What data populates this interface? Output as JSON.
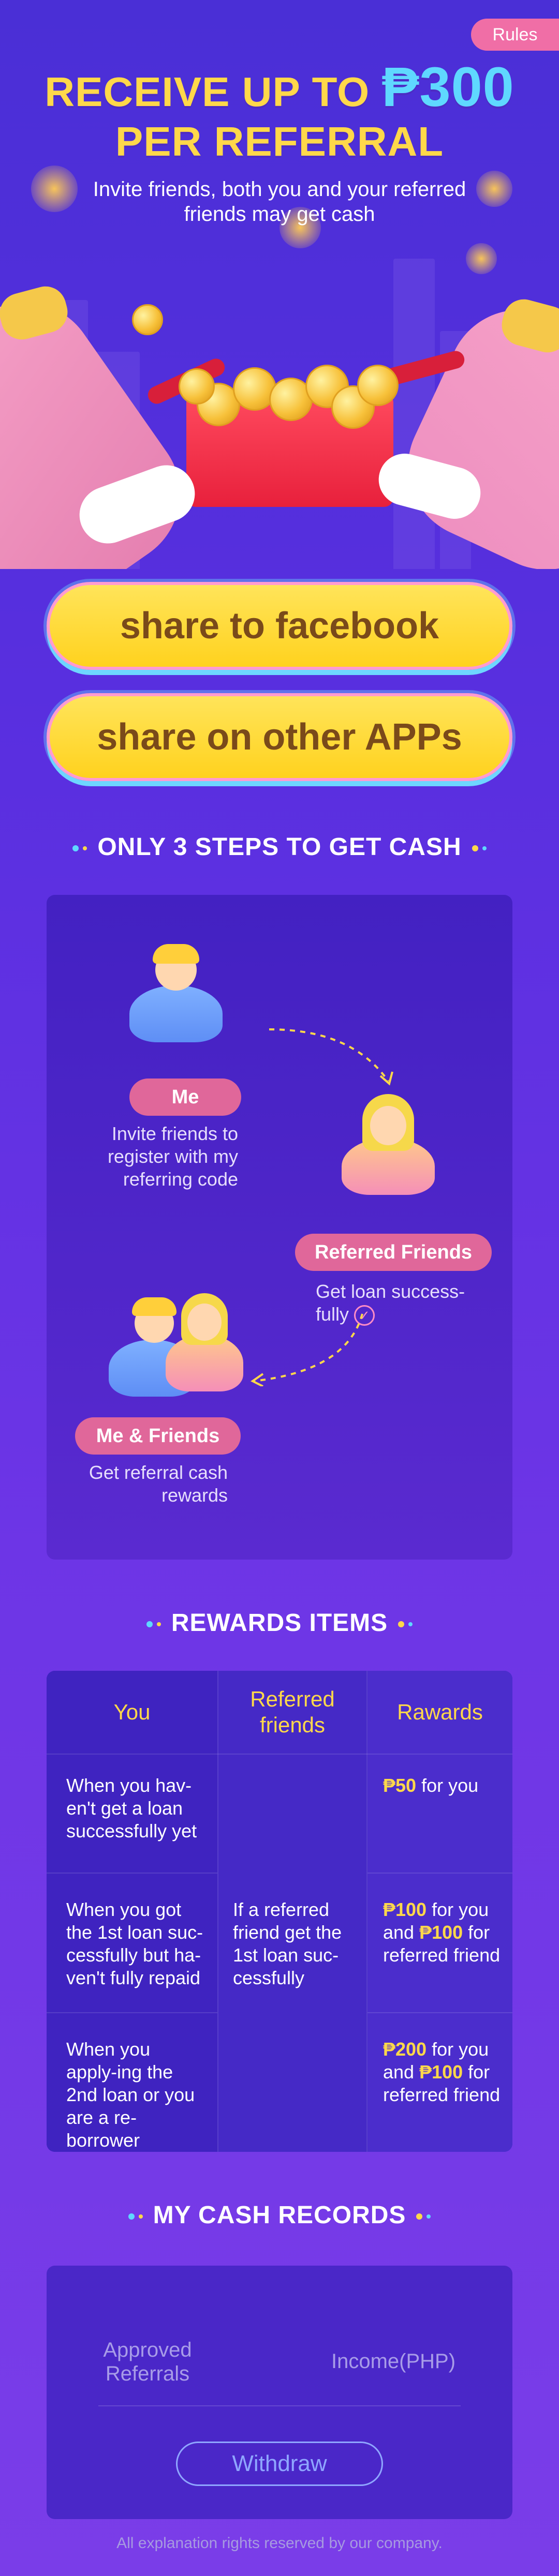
{
  "header": {
    "rules_label": "Rules",
    "title_line1_prefix": "RECEIVE UP TO ",
    "title_amount": "₱300",
    "title_line2": "PER REFERRAL",
    "subtitle": "Invite friends, both you and your referred friends may get cash"
  },
  "buttons": {
    "share_facebook": "share to facebook",
    "share_other": "share on other APPs"
  },
  "steps": {
    "title": "ONLY 3 STEPS TO GET CASH",
    "step1": {
      "label": "Me",
      "desc": "Invite friends to register with my referring code"
    },
    "step2": {
      "label": "Referred Friends",
      "desc": "Get loan success-fully"
    },
    "step3": {
      "label": "Me & Friends",
      "desc": "Get referral cash rewards"
    }
  },
  "rewards": {
    "title": "REWARDS ITEMS",
    "headers": [
      "You",
      "Referred friends",
      "Rawards"
    ],
    "rows": [
      {
        "you": "When you hav-en't get a loan successfully yet",
        "reward_amount": "₱50",
        "reward_text": " for you"
      },
      {
        "you": "When you got the 1st loan suc-cessfully but ha-ven't fully repaid",
        "reward_amount": "₱100",
        "reward_text_a": " for you and ",
        "reward_amount_b": "₱100",
        "reward_text_b": " for referred friend"
      },
      {
        "you": "When you apply-ing the 2nd loan or you are a re-borrower",
        "reward_amount": "₱200",
        "reward_text_a": " for you and ",
        "reward_amount_b": "₱100",
        "reward_text_b": " for referred friend"
      }
    ],
    "referred_condition": "If a referred friend get the 1st loan suc-cessfully"
  },
  "records": {
    "title": "MY CASH RECORDS",
    "approved_label": "Approved Referrals",
    "income_label": "Income(PHP)",
    "withdraw_label": "Withdraw"
  },
  "footer": {
    "text": "All explanation rights reserved by our company."
  },
  "colors": {
    "accent_yellow": "#ffd84a",
    "accent_cyan": "#5fd8ff",
    "pill_pink": "#e0679a",
    "background_purple": "#5a2fe0"
  }
}
